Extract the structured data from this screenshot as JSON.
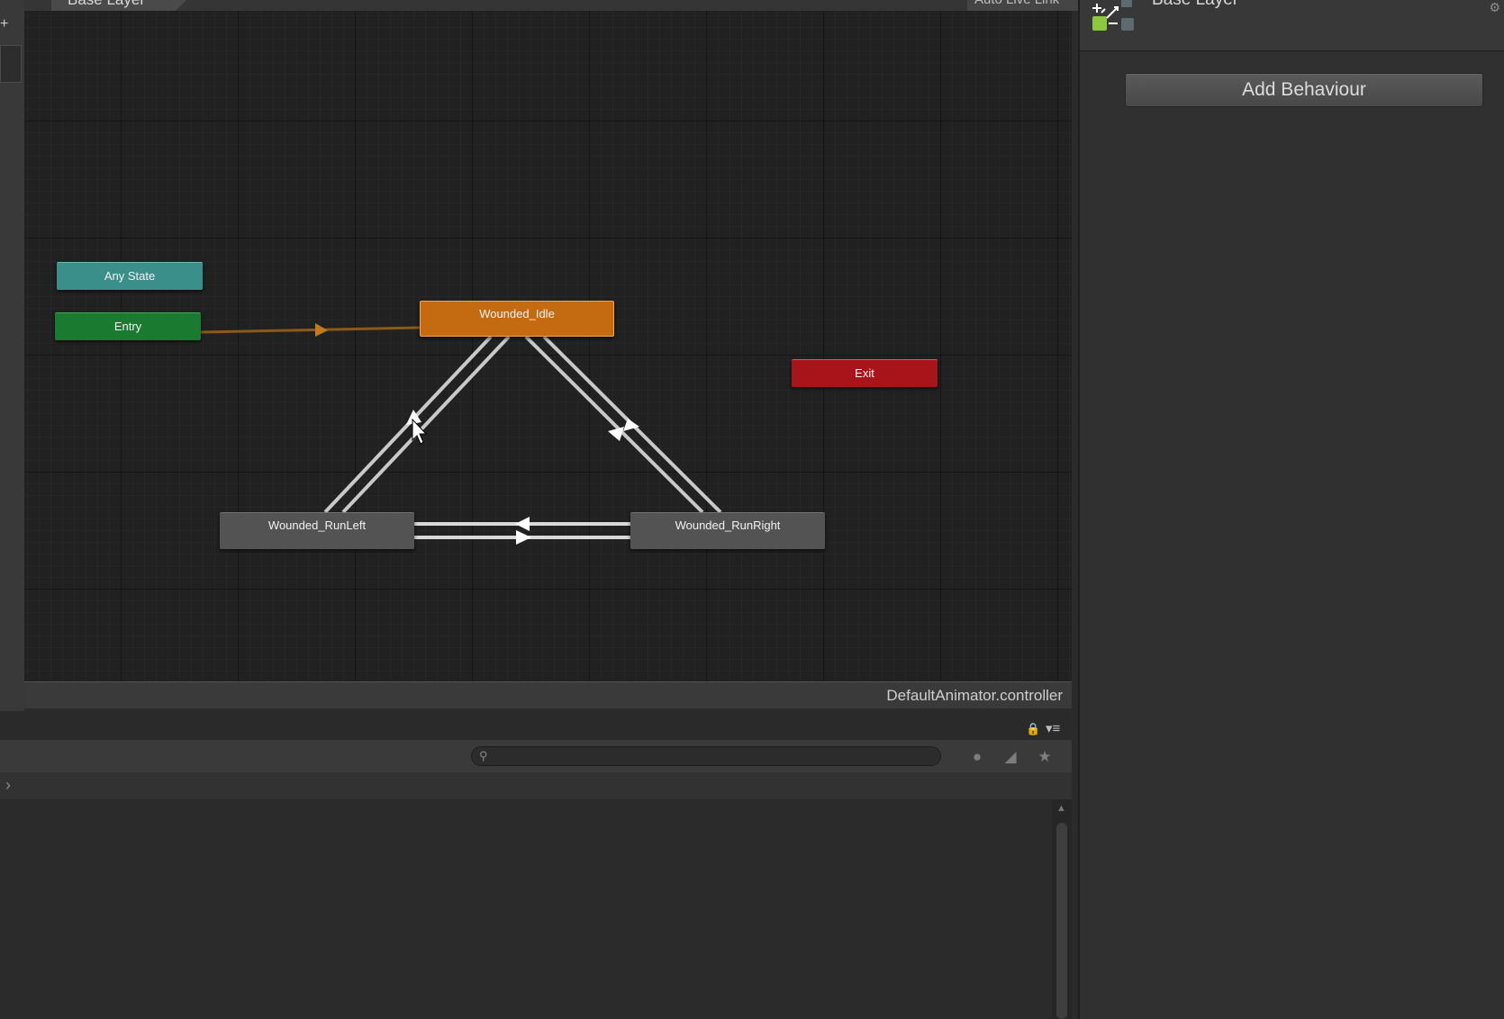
{
  "graph": {
    "breadcrumb": "Base Layer",
    "live_link_label": "Auto Live Link",
    "footer_label": "DefaultAnimator.controller",
    "states": {
      "any_state": "Any State",
      "entry": "Entry",
      "idle": "Wounded_Idle",
      "exit": "Exit",
      "run_left": "Wounded_RunLeft",
      "run_right": "Wounded_RunRight"
    },
    "colors": {
      "any_state": "#3b8f8a",
      "entry": "#1a7a30",
      "default_state": "#c46a10",
      "exit": "#a7151b",
      "state": "#535353",
      "default_transition": "#c46a10",
      "transition": "#d9d9d9"
    }
  },
  "inspector": {
    "title": "Base Layer",
    "add_behaviour_label": "Add Behaviour"
  },
  "bottom_panel": {
    "search_placeholder": ""
  },
  "icons": [
    "plus-icon",
    "layer-icon",
    "lock-icon",
    "menu-icon",
    "search-icon",
    "filter-type-icon",
    "label-icon",
    "favorite-icon",
    "chevron-right-icon",
    "mouse-cursor-icon"
  ]
}
